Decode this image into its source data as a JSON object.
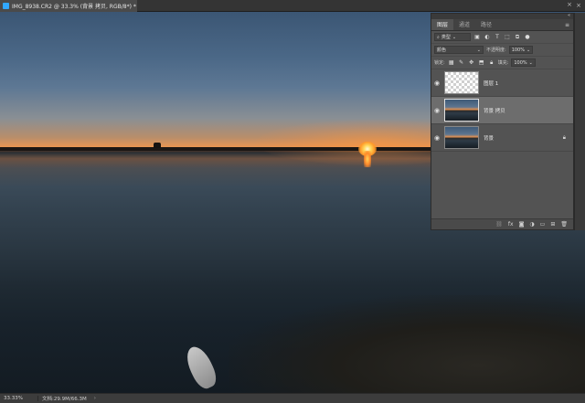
{
  "document": {
    "tab_title": "IMG_8938.CR2 @ 33.3% (背景 拷贝, RGB/8*) *",
    "close_glyph": "×",
    "icon": "photoshop-icon"
  },
  "layers_panel": {
    "tabs": [
      "图层",
      "通道",
      "路径"
    ],
    "menu_glyph": "≡",
    "collapse_glyph": "«",
    "filter": {
      "label": "类型",
      "icons": [
        "image-filter-icon",
        "adjust-filter-icon",
        "type-filter-icon",
        "shape-filter-icon",
        "smart-filter-icon"
      ]
    },
    "blend_mode": "颜色",
    "opacity_label": "不透明度:",
    "opacity_value": "100%",
    "lock_label": "锁定:",
    "fill_label": "填充:",
    "fill_value": "100%",
    "layers": [
      {
        "name": "图层 1",
        "thumb": "transparent",
        "visible": true,
        "selected": false,
        "locked": false
      },
      {
        "name": "背景 拷贝",
        "thumb": "photo",
        "visible": true,
        "selected": true,
        "locked": false
      },
      {
        "name": "背景",
        "thumb": "photo",
        "visible": true,
        "selected": false,
        "locked": true
      }
    ],
    "footer_icons": [
      "link-icon",
      "fx-icon",
      "mask-icon",
      "adjustment-icon",
      "folder-icon",
      "new-layer-icon",
      "trash-icon"
    ]
  },
  "status_bar": {
    "zoom": "33.33%",
    "doc_info": "文档:29.9M/66.3M",
    "arrow": "›"
  }
}
